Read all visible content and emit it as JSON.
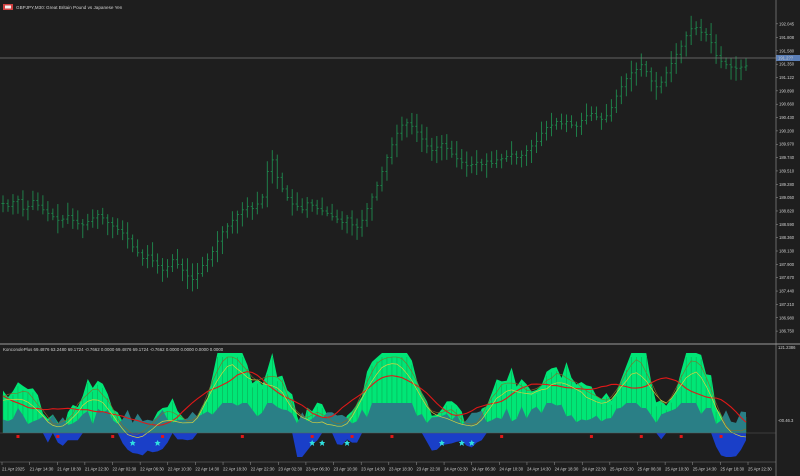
{
  "window": {
    "symbol_label": "GBPJPY,M30:",
    "description": "Great Britain Pound vs Japanese Yen"
  },
  "colors": {
    "background": "#1e1e1e",
    "bars": "#1e8a4e",
    "separator": "#9a9a9a",
    "price_marker": "#5b7fb8",
    "indicator_green": "#00e676",
    "indicator_green_dark": "#0fa050",
    "indicator_blue": "#1a3fc8",
    "indicator_teal": "#2a7f86",
    "signal_red": "#e01818",
    "signal_yellow": "#d4d040",
    "signal_brown": "#8a6a28",
    "marker_red": "#e01818",
    "marker_cyan": "#30e0e0",
    "text": "#cfcfcf"
  },
  "indicator": {
    "label": "KonconolePlus 69.4876 63.2480 69.1724 -0.7662 0.0000 69.4876 69.1724 -0.7662 0.0000 0.0000 0.0000 0.0000",
    "axis_labels": [
      "121.2386",
      "-00.46.3"
    ],
    "scale_max_label": "121.2386",
    "scale_min_label": "-00.46.3"
  },
  "price_marker_label": "191.2??",
  "icons": {
    "window_icon": "chart-window-icon"
  },
  "chart_data": {
    "type": "bar",
    "symbol": "GBPJPY",
    "timeframe": "M30",
    "y_axis_labels": [
      "192.045",
      "191.808",
      "191.580",
      "191.350",
      "191.122",
      "190.890",
      "190.660",
      "190.430",
      "190.200",
      "189.970",
      "189.740",
      "189.510",
      "189.280",
      "189.050",
      "188.820",
      "188.590",
      "188.360",
      "188.130",
      "187.900",
      "187.670",
      "187.440",
      "187.210",
      "186.980",
      "186.750"
    ],
    "x_axis_labels": [
      "21 Apr 2025",
      "21 Apr 14:30",
      "21 Apr 18:30",
      "21 Apr 22:30",
      "22 Apr 02:30",
      "22 Apr 06:30",
      "22 Apr 10:30",
      "22 Apr 14:30",
      "22 Apr 18:30",
      "22 Apr 22:30",
      "23 Apr 02:30",
      "23 Apr 06:30",
      "23 Apr 10:30",
      "23 Apr 14:30",
      "23 Apr 18:30",
      "23 Apr 22:30",
      "24 Apr 02:30",
      "24 Apr 06:30",
      "24 Apr 10:30",
      "24 Apr 14:30",
      "24 Apr 18:30",
      "24 Apr 22:30",
      "25 Apr 02:30",
      "25 Apr 06:30",
      "25 Apr 10:30",
      "25 Apr 14:30",
      "25 Apr 18:30",
      "25 Apr 22:30"
    ],
    "horizontal_line": 191.232,
    "ylim": [
      186.7,
      192.18
    ],
    "close_series": [
      188.95,
      188.9,
      188.98,
      189.02,
      188.85,
      188.9,
      189.0,
      188.92,
      188.84,
      188.78,
      188.72,
      188.66,
      188.68,
      188.74,
      188.66,
      188.6,
      188.58,
      188.64,
      188.7,
      188.76,
      188.7,
      188.62,
      188.56,
      188.5,
      188.44,
      188.34,
      188.2,
      188.1,
      188.0,
      188.06,
      187.96,
      187.88,
      187.8,
      187.86,
      187.98,
      187.9,
      187.8,
      187.7,
      187.64,
      187.74,
      187.88,
      187.98,
      188.12,
      188.3,
      188.46,
      188.56,
      188.66,
      188.76,
      188.84,
      188.9,
      188.86,
      188.94,
      189.06,
      189.5,
      189.7,
      189.4,
      189.2,
      189.05,
      188.94,
      188.9,
      188.84,
      188.96,
      188.92,
      188.86,
      188.82,
      188.78,
      188.72,
      188.68,
      188.62,
      188.7,
      188.58,
      188.54,
      188.66,
      188.86,
      189.06,
      189.26,
      189.5,
      189.74,
      189.96,
      190.16,
      190.3,
      190.34,
      190.28,
      190.18,
      190.06,
      189.94,
      189.86,
      189.92,
      189.98,
      189.9,
      189.8,
      189.72,
      189.66,
      189.6,
      189.62,
      189.66,
      189.62,
      189.68,
      189.64,
      189.7,
      189.72,
      189.76,
      189.8,
      189.74,
      189.78,
      189.86,
      189.94,
      190.02,
      190.16,
      190.26,
      190.3,
      190.36,
      190.32,
      190.36,
      190.3,
      190.28,
      190.38,
      190.46,
      190.5,
      190.44,
      190.4,
      190.46,
      190.6,
      190.8,
      190.96,
      191.1,
      191.2,
      191.26,
      191.34,
      191.22,
      191.06,
      190.96,
      191.04,
      191.2,
      191.36,
      191.52,
      191.66,
      191.84,
      191.96,
      191.98,
      191.9,
      191.86,
      191.72,
      191.5,
      191.4,
      191.34,
      191.3,
      191.28,
      191.3,
      191.32
    ]
  }
}
